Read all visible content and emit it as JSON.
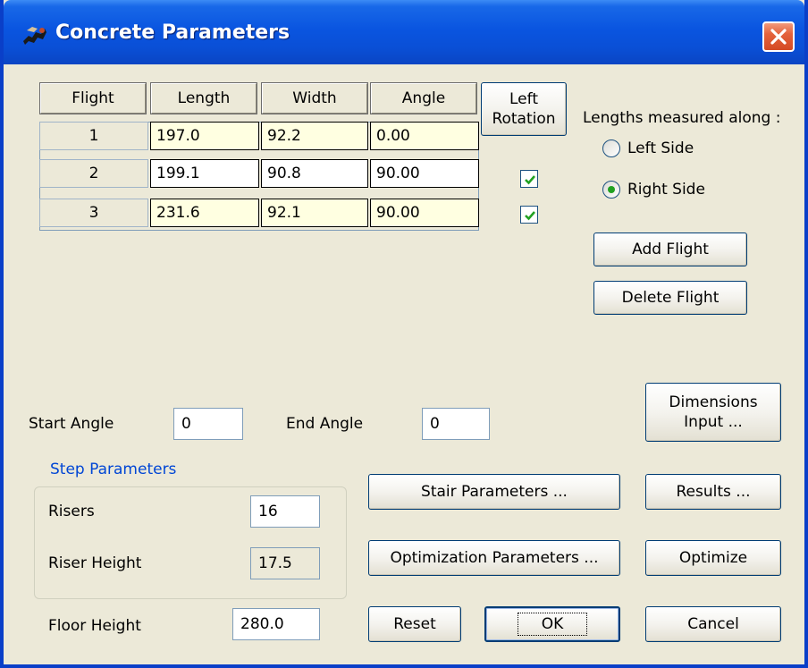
{
  "window": {
    "title": "Concrete Parameters",
    "icon": "stairs-app-icon",
    "close_icon": "close-icon",
    "titlebar_color": "#0a55e0"
  },
  "grid": {
    "headers": [
      "Flight",
      "Length",
      "Width",
      "Angle"
    ],
    "left_rotation_header": [
      "Left",
      "Rotation"
    ],
    "rows": [
      {
        "flight": "1",
        "length": "197.0",
        "width": "92.2",
        "angle": "0.00",
        "left_rotation": null
      },
      {
        "flight": "2",
        "length": "199.1",
        "width": "90.8",
        "angle": "90.00",
        "left_rotation": true
      },
      {
        "flight": "3",
        "length": "231.6",
        "width": "92.1",
        "angle": "90.00",
        "left_rotation": true
      }
    ]
  },
  "lengths": {
    "label": "Lengths measured along :",
    "options": [
      {
        "label": "Left Side",
        "selected": false
      },
      {
        "label": "Right Side",
        "selected": true
      }
    ]
  },
  "buttons": {
    "add_flight": "Add Flight",
    "delete_flight": "Delete Flight",
    "dimensions_input": [
      "Dimensions",
      "Input ..."
    ],
    "stair_parameters": "Stair Parameters ...",
    "results": "Results ...",
    "optimization_parameters": "Optimization Parameters ...",
    "optimize": "Optimize",
    "reset": "Reset",
    "ok": "OK",
    "cancel": "Cancel"
  },
  "angles": {
    "start_label": "Start Angle",
    "start_value": "0",
    "end_label": "End Angle",
    "end_value": "0"
  },
  "step_parameters": {
    "title": "Step Parameters",
    "risers_label": "Risers",
    "risers_value": "16",
    "riser_height_label": "Riser Height",
    "riser_height_value": "17.5"
  },
  "floor_height": {
    "label": "Floor Height",
    "value": "280.0"
  },
  "colors": {
    "highlight_cell": "#ffffe1",
    "check_green": "#21a121",
    "group_title": "#0046d5"
  }
}
